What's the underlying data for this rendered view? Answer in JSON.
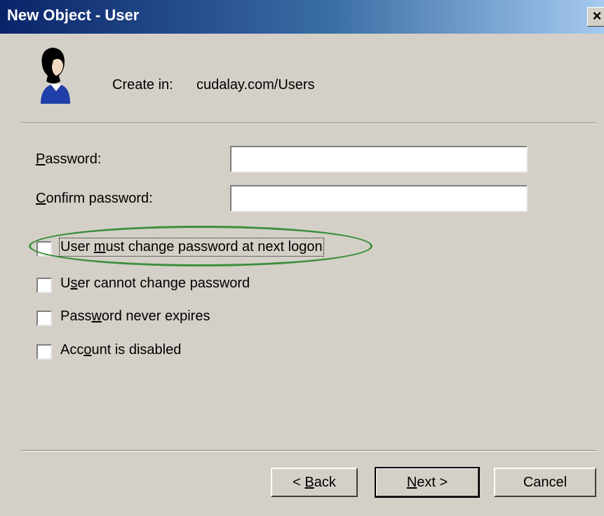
{
  "window": {
    "title": "New Object - User",
    "close_glyph": "×"
  },
  "header": {
    "icon": "user-icon",
    "create_in_label": "Create in:",
    "create_in_value": "cudalay.com/Users"
  },
  "fields": {
    "password": {
      "label_accel": "P",
      "label_rest": "assword:",
      "value": ""
    },
    "confirm": {
      "label_accel": "C",
      "label_rest": "onfirm password:",
      "value": ""
    }
  },
  "options": [
    {
      "pre": "User ",
      "accel": "m",
      "post": "ust change password at next logon",
      "checked": false,
      "highlighted": true
    },
    {
      "pre": "U",
      "accel": "s",
      "post": "er cannot change password",
      "checked": false
    },
    {
      "pre": "Pass",
      "accel": "w",
      "post": "ord never expires",
      "checked": false
    },
    {
      "pre": "Acc",
      "accel": "o",
      "post": "unt is disabled",
      "checked": false
    }
  ],
  "buttons": {
    "back": {
      "pre": "< ",
      "accel": "B",
      "post": "ack"
    },
    "next": {
      "pre": "",
      "accel": "N",
      "post": "ext >"
    },
    "cancel": {
      "label": "Cancel"
    }
  },
  "colors": {
    "titlebar_start": "#0a246a",
    "titlebar_end": "#a6caf0",
    "dialog_bg": "#d4d0c8",
    "annotation": "#3c8f3c"
  }
}
